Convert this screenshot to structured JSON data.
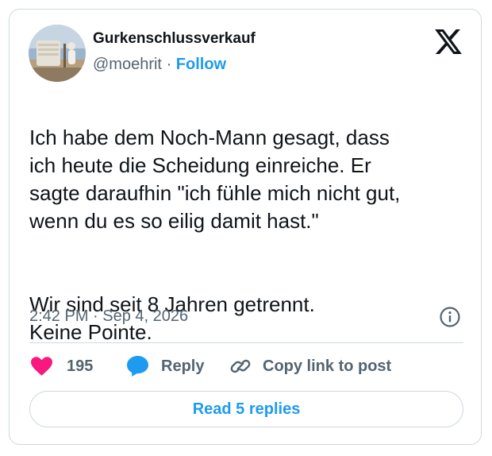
{
  "author": {
    "display_name": "Gurkenschlussverkauf",
    "handle": "@moehrit",
    "separator": "·",
    "follow_label": "Follow"
  },
  "tweet": {
    "paragraph_1": "Ich habe dem Noch-Mann gesagt, dass\nich heute die Scheidung einreiche. Er\nsagte daraufhin \"ich fühle mich nicht gut,\nwenn du es so eilig damit hast.\"",
    "paragraph_2": "Wir sind seit 8 Jahren getrennt.\nKeine Pointe.",
    "timestamp": "2:42 PM · Sep 4, 2026"
  },
  "actions": {
    "like_count": "195",
    "reply_label": "Reply",
    "copy_link_label": "Copy link to post"
  },
  "read_replies_label": "Read 5 replies",
  "colors": {
    "accent": "#1d9bf0",
    "like": "#f91880",
    "text": "#0f1419",
    "secondary_text": "#536471",
    "border": "#cfd9de"
  },
  "icons": {
    "logo": "x-logo-icon",
    "info": "info-icon",
    "like": "heart-icon",
    "reply": "speech-bubble-icon",
    "copy_link": "link-icon"
  }
}
